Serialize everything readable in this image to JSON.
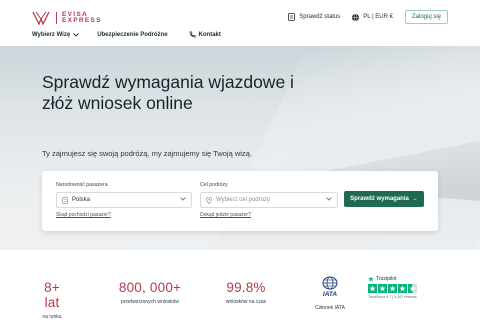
{
  "brand": {
    "line1": "EVISA",
    "line2": "EXPRESS",
    "color": "#b33b4b"
  },
  "header": {
    "status_label": "Sprawdź status",
    "locale_label": "PL | EUR €",
    "login_label": "Zaloguj się"
  },
  "nav": {
    "items": [
      {
        "label": "Wybierz Wizę",
        "has_dropdown": true
      },
      {
        "label": "Ubezpieczenie Podróżne"
      },
      {
        "label": "Kontakt"
      }
    ]
  },
  "hero": {
    "title": "Sprawdź wymagania wjazdowe i złóż wniosek online",
    "subtitle": "Ty zajmujesz się swoją podróżą, my zajmujemy się Twoją wizą."
  },
  "form": {
    "nationality_label": "Narodowość pasażera",
    "nationality_value": "Polska",
    "nationality_helper": "Skąd pochodzi pasażer?",
    "destination_label": "Cel podróży",
    "destination_placeholder": "Wybierz cel podróży",
    "destination_helper": "Dokąd jedzie pasażer?",
    "submit_label": "Sprawdź wymagania",
    "submit_arrow": "→",
    "accent": "#1f6b4f"
  },
  "stats": [
    {
      "value": "8+ lat",
      "label": "na rynku"
    },
    {
      "value": "800, 000+",
      "label": "przetworzonych wniosków"
    },
    {
      "value": "99.8%",
      "label": "wniosków na czas"
    }
  ],
  "iata": {
    "logo_text": "IATA",
    "label": "Członek IATA"
  },
  "trustpilot": {
    "brand": "Trustpilot",
    "rating_stars": 4.5,
    "note": "TrustScore 4.7 | 5,367 reviews",
    "color": "#00b67a"
  }
}
